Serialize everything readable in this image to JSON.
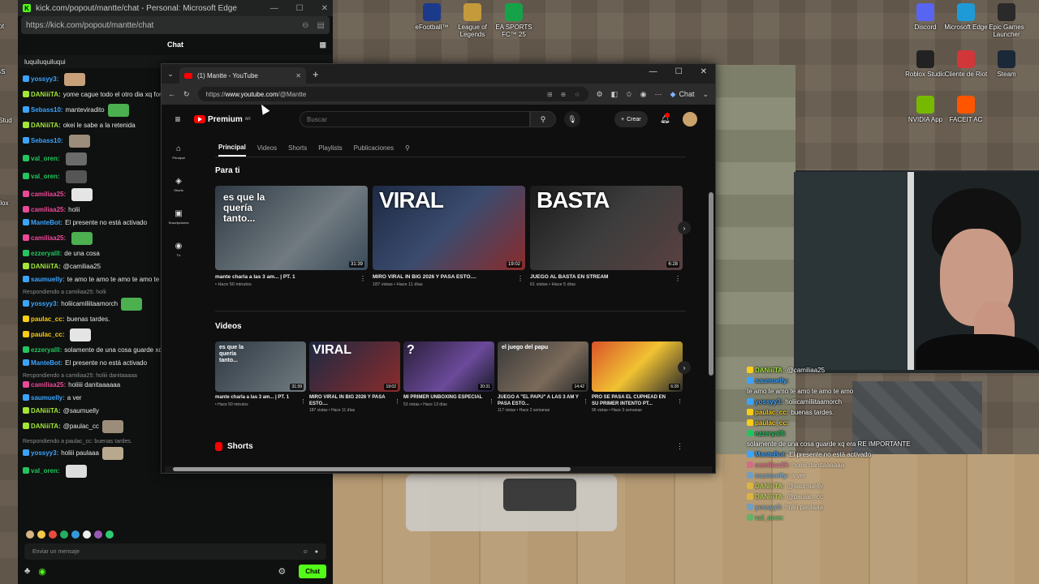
{
  "desktop": {
    "icons": [
      {
        "label": "eFootball™",
        "color": "#1b3b8a"
      },
      {
        "label": "League of Legends",
        "color": "#c49a3a"
      },
      {
        "label": "EA SPORTS FC™ 25",
        "color": "#15a34a"
      },
      {
        "label": "Discord",
        "color": "#5865f2"
      },
      {
        "label": "Microsoft Edge",
        "color": "#1e9ad6"
      },
      {
        "label": "Epic Games Launcher",
        "color": "#2a2a2a"
      },
      {
        "label": "Roblox Studio",
        "color": "#222222"
      },
      {
        "label": "Cliente de Riot",
        "color": "#d13639"
      },
      {
        "label": "Steam",
        "color": "#1b2838"
      },
      {
        "label": "NVIDIA App",
        "color": "#76b900"
      },
      {
        "label": "FACEIT AC",
        "color": "#ff5500"
      }
    ],
    "left_labels": [
      "Riot",
      "OBS",
      "Rob Stud",
      "Roblox"
    ]
  },
  "kick": {
    "window_title": "kick.com/popout/mantte/chat - Personal: Microsoft Edge",
    "url": "https://kick.com/popout/mantte/chat",
    "chat_header": "Chat",
    "pinned": "luquiluquiluqui",
    "messages": [
      {
        "user": "yossyy3:",
        "text": "",
        "color": "#3ba4ff",
        "emote": "#c8a17a"
      },
      {
        "user": "DANiiiTA:",
        "text": "yome cague todo el otro dia xq forme en el drive",
        "color": "#a3e635"
      },
      {
        "user": "Sebass10:",
        "text": "manteviradito",
        "color": "#3ba4ff",
        "emote": "#4caf50"
      },
      {
        "user": "DANiiiTA:",
        "text": "okei le sabe a la retenida",
        "color": "#a3e635"
      },
      {
        "user": "Sebass10:",
        "text": "",
        "color": "#3ba4ff",
        "emote": "#9c8d7a"
      },
      {
        "user": "val_oren:",
        "text": "",
        "color": "#22c55e",
        "emote": "#6b6b6b"
      },
      {
        "user": "val_oren:",
        "text": "",
        "color": "#22c55e",
        "emote": "#555555"
      },
      {
        "user": "camiliaa25:",
        "text": "",
        "color": "#ec4899",
        "emote": "#e5e5e5"
      },
      {
        "user": "camiliaa25:",
        "text": "holii",
        "color": "#ec4899"
      },
      {
        "user": "ManteBot:",
        "text": "El presente no está activado",
        "color": "#3ba4ff"
      },
      {
        "user": "camiliaa25:",
        "text": "",
        "color": "#ec4899",
        "emote": "#4caf50"
      },
      {
        "user": "ezzeryalll:",
        "text": "de una cosa",
        "color": "#22c55e"
      },
      {
        "user": "DANiiiTA:",
        "text": "@camiliaa25",
        "color": "#a3e635"
      },
      {
        "user": "saumuelly:",
        "text": "te amo te amo te amo te amo te amo",
        "color": "#3ba4ff"
      },
      {
        "reply": "Respondiendo a camiliaa25: holii"
      },
      {
        "user": "yossyy3:",
        "text": "holiicamiliitaamorch",
        "color": "#3ba4ff",
        "emote": "#4caf50"
      },
      {
        "user": "paulac_cc:",
        "text": "buenas tardes.",
        "color": "#facc15"
      },
      {
        "user": "paulac_cc:",
        "text": "",
        "color": "#facc15",
        "emote": "#e5e5e5"
      },
      {
        "user": "ezzeryalll:",
        "text": "solamente de una cosa guarde xq era RE IMPORTANTE",
        "color": "#22c55e"
      },
      {
        "user": "ManteBot:",
        "text": "El presente no está activado",
        "color": "#3ba4ff"
      },
      {
        "reply": "Respondiendo a camiliaa25: holiii danitaaaaa"
      },
      {
        "user": "camiliaa25:",
        "text": "holiiii danitaaaaaa",
        "color": "#ec4899"
      },
      {
        "user": "saumuelly:",
        "text": "a ver",
        "color": "#3ba4ff"
      },
      {
        "user": "DANiiiTA:",
        "text": "@saumuelly",
        "color": "#a3e635"
      },
      {
        "user": "DANiiiTA:",
        "text": "@paulac_cc",
        "color": "#a3e635",
        "emote": "#9c8d7a"
      },
      {
        "reply": "Respondiendo a paulac_cc: buenas tardes."
      },
      {
        "user": "yossyy3:",
        "text": "holiii paulaaa",
        "color": "#3ba4ff",
        "emote": "#b8a98e"
      },
      {
        "user": "val_oren:",
        "text": "",
        "color": "#22c55e",
        "emote": "#dddddd"
      }
    ],
    "input_placeholder": "Enviar un mensaje",
    "chat_button": "Chat"
  },
  "edge": {
    "tab_title": "(1) Mantte - YouTube",
    "url_prefix": "https://",
    "url_host": "www.youtube.com",
    "url_path": "/@Mantte",
    "chat_label": "Chat"
  },
  "youtube": {
    "logo": "Premium",
    "logo_region": "AR",
    "search_placeholder": "Buscar",
    "create_label": "Crear",
    "sidebar": [
      {
        "icon": "home-icon",
        "glyph": "⌂",
        "label": "Principal"
      },
      {
        "icon": "shorts-icon",
        "glyph": "◈",
        "label": "Shorts"
      },
      {
        "icon": "subscriptions-icon",
        "glyph": "▣",
        "label": "Suscripciones"
      },
      {
        "icon": "you-icon",
        "glyph": "◉",
        "label": "Tú"
      }
    ],
    "channel_tabs": [
      "Principal",
      "Videos",
      "Shorts",
      "Playlists",
      "Publicaciones"
    ],
    "for_you_title": "Para ti",
    "for_you": [
      {
        "title": "mante charla a las 3 am... | PT. 1",
        "meta": "• Hace 50 minutos",
        "duration": "31:39",
        "thumb_text": "es que la\nquería\ntanto...",
        "bg": "linear-gradient(135deg,#2f3a44,#707a80 60%,#3a4a5a)"
      },
      {
        "title": "MIRO VIRAL IN BIG 2026 Y PASA ESTO....",
        "meta": "187 vistas • Hace 11 días",
        "duration": "19:02",
        "thumb_text": "VIRAL",
        "bg": "linear-gradient(135deg,#1d2a44,#3b4b6e 50%,#8a2b2b)"
      },
      {
        "title": "JUEGO AL BASTA EN STREAM",
        "meta": "61 vistas • Hace 5 días",
        "duration": "6:28",
        "thumb_text": "BASTA",
        "bg": "linear-gradient(135deg,#1b1b1b,#3d3d3d 50%,#5a4040)"
      }
    ],
    "videos_title": "Videos",
    "videos": [
      {
        "title": "mante charla a las 3 am... | PT. 1",
        "meta": "• Hace 50 minutos",
        "duration": "31:39",
        "thumb_text": "es que la\nquería\ntanto...",
        "bg": "linear-gradient(135deg,#2f3a44,#707a80)"
      },
      {
        "title": "MIRO VIRAL IN BIG 2026 Y PASA ESTO....",
        "meta": "187 vistas • Hace 11 días",
        "duration": "19:02",
        "thumb_text": "VIRAL",
        "bg": "linear-gradient(135deg,#1d2a44,#8a2b2b)"
      },
      {
        "title": "MI PRIMER UNBOXING ESPECIAL",
        "meta": "53 vistas • Hace 13 días",
        "duration": "20:31",
        "thumb_text": "?",
        "bg": "linear-gradient(135deg,#2a1f3a,#6b4a9a 60%,#1a1a2a)"
      },
      {
        "title": "JUEGO A \"EL PAPU\" A LAS 3 AM Y PASA ESTO...",
        "meta": "117 vistas • Hace 2 semanas",
        "duration": "14:42",
        "thumb_text": "el juego del papu",
        "bg": "linear-gradient(135deg,#3a3a3a,#7a6a5a 60%,#2a2a2a)"
      },
      {
        "title": "PRO SE PASA EL CUPHEAD EN SU PRIMER INTENTO PT...",
        "meta": "96 vistas • Hace 3 semanas",
        "duration": "6:28",
        "thumb_text": "",
        "bg": "linear-gradient(135deg,#d9532b,#f1c232 50%,#2a2a2a)"
      }
    ],
    "shorts_title": "Shorts"
  },
  "overlay_chat": [
    {
      "user": "DANiiiTA:",
      "text": "@camiliaa25",
      "color": "#a3e635",
      "badge": "#facc15"
    },
    {
      "user": "saumuelly:",
      "text": "",
      "color": "#3ba4ff",
      "badge": "#3ba4ff"
    },
    {
      "user": "",
      "text": "te amo te amo te amo te amo te amo",
      "color": "#fff",
      "badge": ""
    },
    {
      "user": "yossyy3:",
      "text": "holiicamiliitaamorch",
      "color": "#3ba4ff",
      "badge": "#3ba4ff"
    },
    {
      "user": "paulac_cc:",
      "text": "buenas tardes.",
      "color": "#facc15",
      "badge": "#facc15"
    },
    {
      "user": "paulac_cc:",
      "text": "",
      "color": "#facc15",
      "badge": "#facc15"
    },
    {
      "user": "ezzeryalll:",
      "text": "",
      "color": "#22c55e",
      "badge": "#22c55e"
    },
    {
      "user": "",
      "text": "solamente de una cosa guarde xq era RE IMPORTANTE",
      "color": "#fff",
      "badge": ""
    },
    {
      "user": "ManteBot:",
      "text": "El presente no está activado",
      "color": "#3ba4ff",
      "badge": "#3ba4ff"
    },
    {
      "user": "camiliaa25:",
      "text": "holiiii danitaaaaaa",
      "color": "#ec4899",
      "badge": "#ec4899",
      "dim": true
    },
    {
      "user": "saumuelly:",
      "text": "a ver",
      "color": "#3ba4ff",
      "badge": "#3ba4ff",
      "dim": true
    },
    {
      "user": "DANiiiTA:",
      "text": "@saumuelly",
      "color": "#a3e635",
      "badge": "#facc15",
      "dim": true
    },
    {
      "user": "DANiiiTA:",
      "text": "@paulac_cc",
      "color": "#a3e635",
      "badge": "#facc15",
      "dim": true
    },
    {
      "user": "yossyy3:",
      "text": "holiii paulaaa",
      "color": "#3ba4ff",
      "badge": "#3ba4ff",
      "dim": true
    },
    {
      "user": "val_oren:",
      "text": "",
      "color": "#22c55e",
      "badge": "#22c55e",
      "dim": true
    }
  ]
}
